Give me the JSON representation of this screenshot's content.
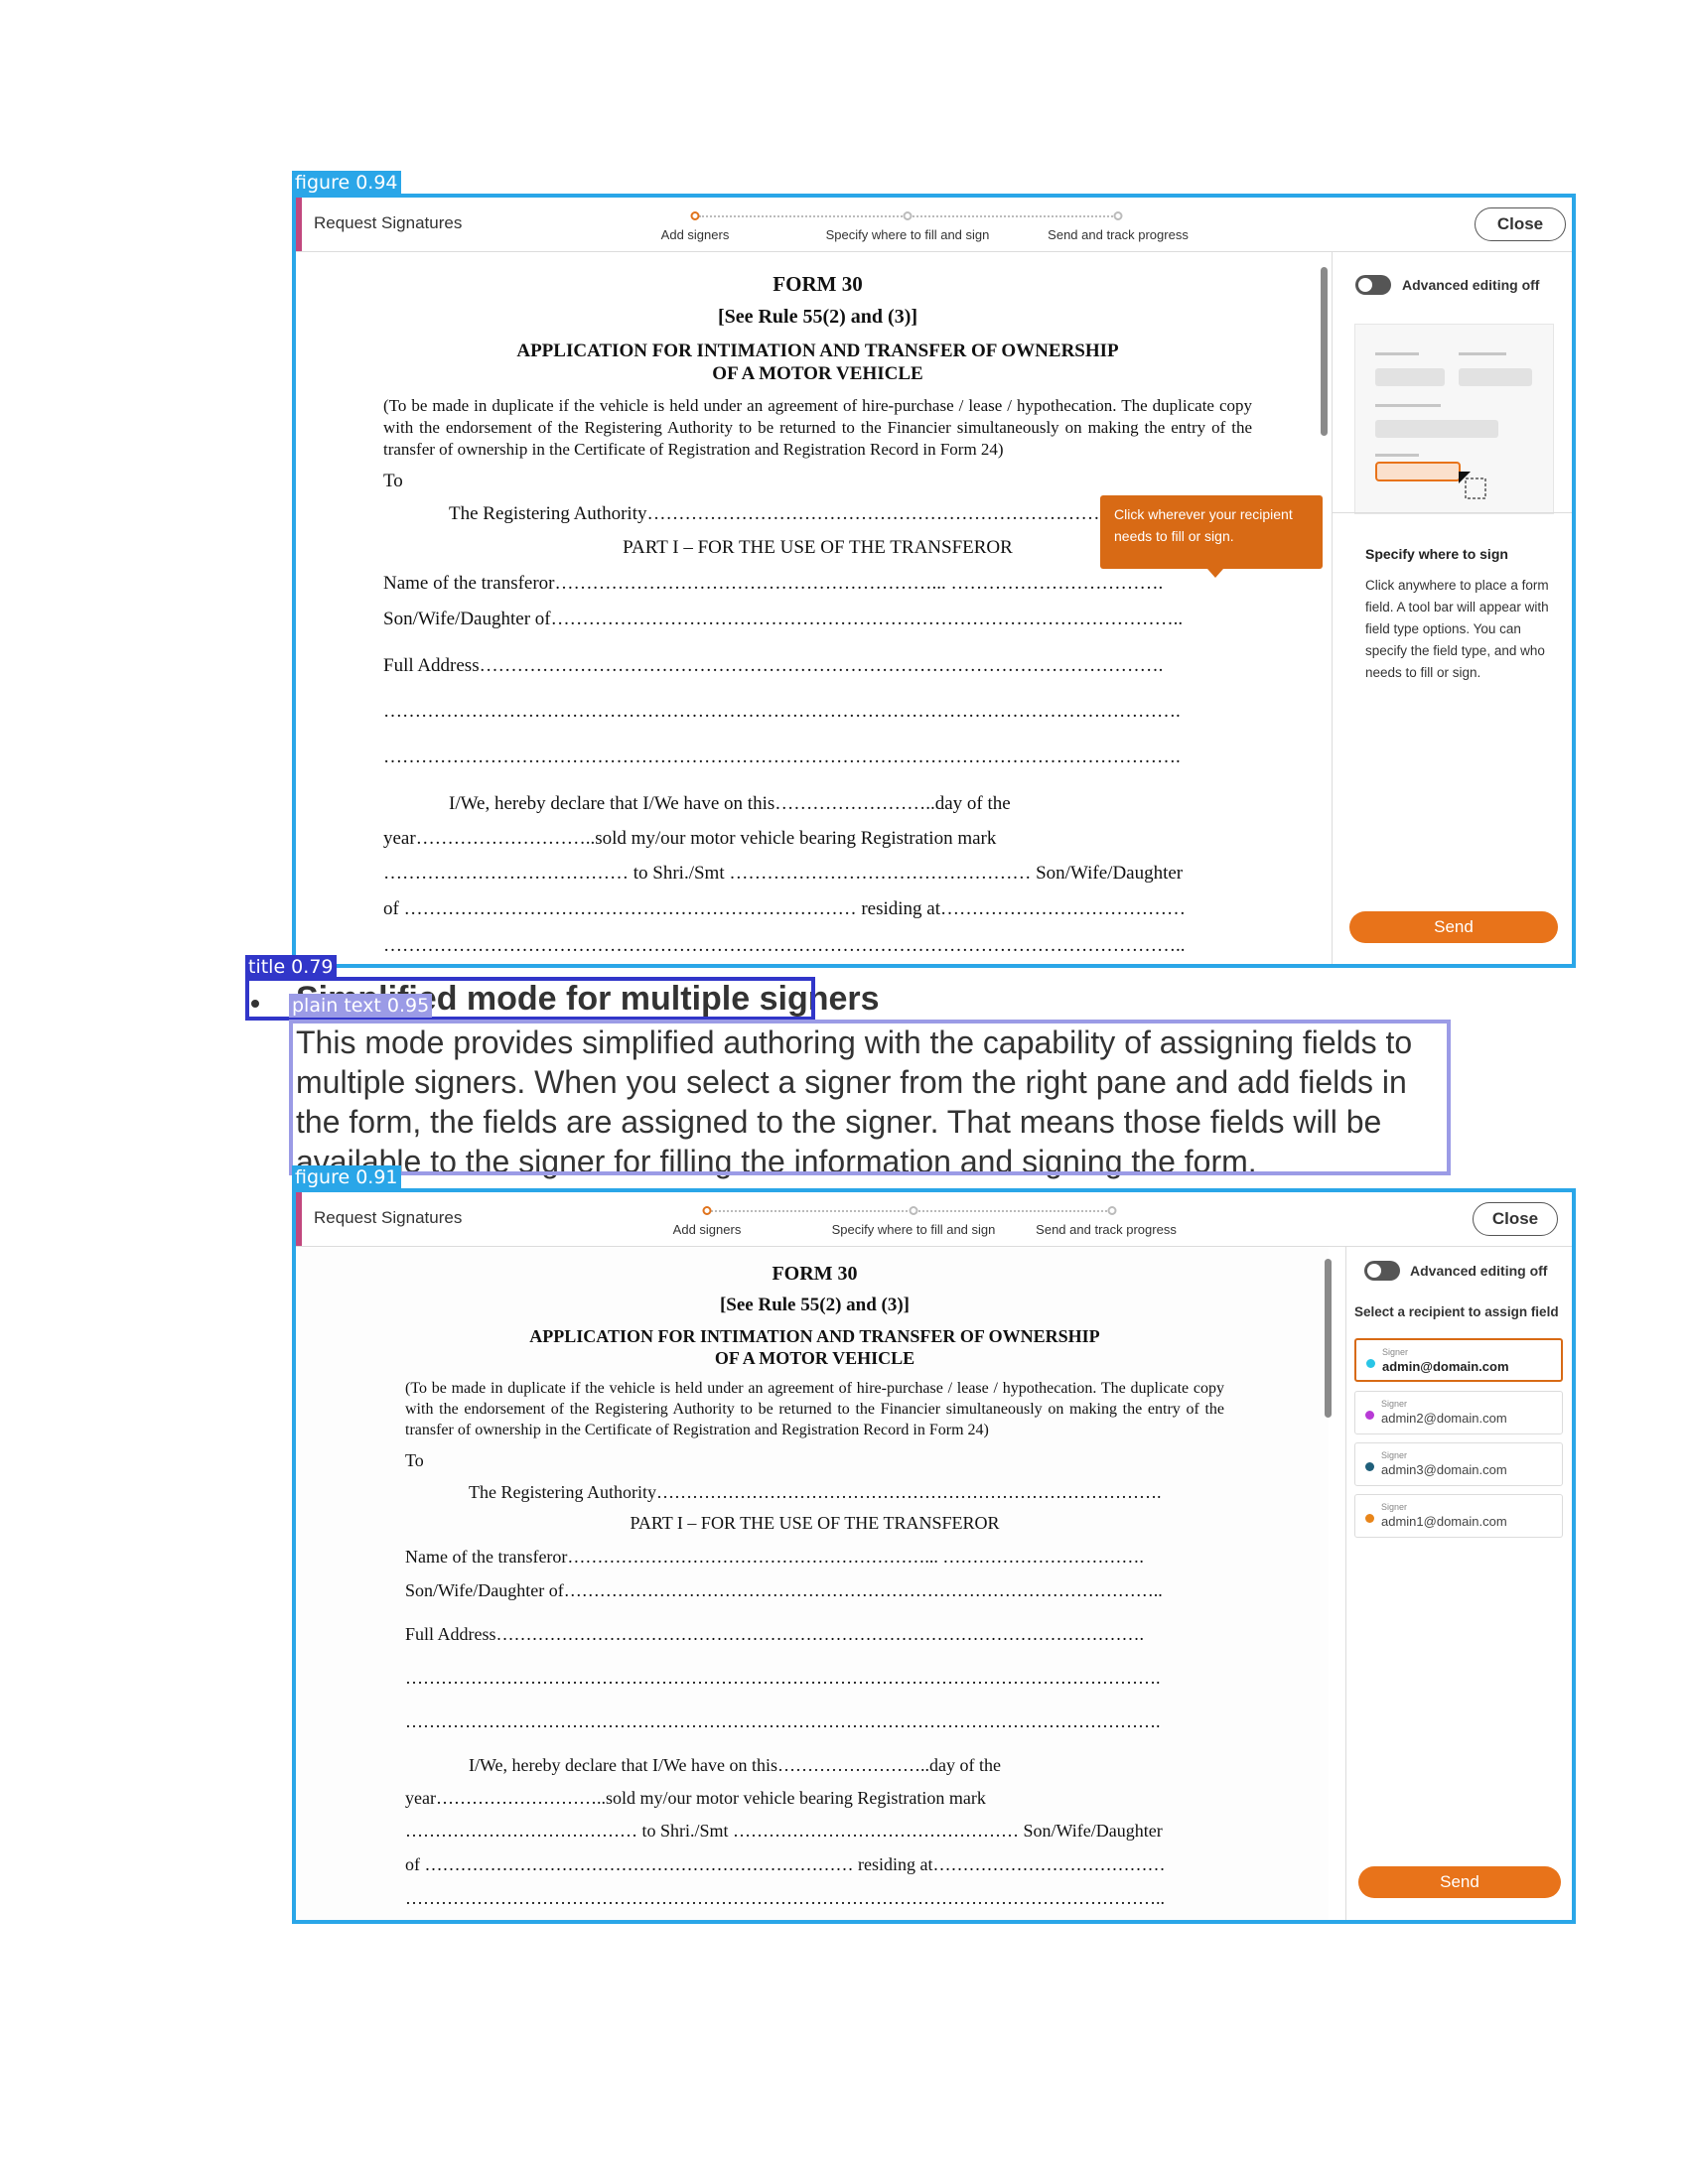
{
  "detections": {
    "figure_top": "figure 0.94",
    "title": "title 0.79",
    "plain_text": "plain text 0.95",
    "figure_bottom": "figure 0.91"
  },
  "colors": {
    "accent": "#e8731a",
    "figure_box": "#2aa6e8",
    "title_box": "#3136c9",
    "plain_box": "#9b9be6",
    "header_accent": "#c2487e"
  },
  "top_shot": {
    "header_title": "Request Signatures",
    "steps": [
      "Add signers",
      "Specify where to fill and sign",
      "Send and track progress"
    ],
    "active_step": 0,
    "close_label": "Close",
    "toggle_label": "Advanced editing off",
    "tooltip": "Click wherever your recipient needs to fill or sign.",
    "help_title": "Specify where to sign",
    "help_text": "Click anywhere to place a form field. A tool bar will appear with field type options. You can specify the field type, and who needs to fill or sign.",
    "send_label": "Send"
  },
  "bottom_shot": {
    "header_title": "Request Signatures",
    "steps": [
      "Add signers",
      "Specify where to fill and sign",
      "Send and track progress"
    ],
    "active_step": 0,
    "close_label": "Close",
    "toggle_label": "Advanced editing off",
    "select_label": "Select a recipient to assign field",
    "signers": [
      {
        "role": "Signer",
        "email": "admin@domain.com",
        "color": "#29c5e6",
        "selected": true
      },
      {
        "role": "Signer",
        "email": "admin2@domain.com",
        "color": "#b83ad6",
        "selected": false
      },
      {
        "role": "Signer",
        "email": "admin3@domain.com",
        "color": "#1f5f7a",
        "selected": false
      },
      {
        "role": "Signer",
        "email": "admin1@domain.com",
        "color": "#e8851a",
        "selected": false
      }
    ],
    "send_label": "Send"
  },
  "form": {
    "title": "FORM 30",
    "rule": "[See Rule 55(2) and (3)]",
    "heading1": "APPLICATION FOR INTIMATION AND TRANSFER OF OWNERSHIP",
    "heading2": "OF A MOTOR VEHICLE",
    "note": "(To be made in duplicate if the vehicle is held under an agreement of hire-purchase / lease / hypothecation. The duplicate copy with the endorsement of the Registering Authority to be returned to the Financier simultaneously on making the entry of the transfer of ownership in the Certificate of Registration and Registration Record in Form 24)",
    "to": "To",
    "authority": "The Registering Authority………………………………………………………………………….",
    "part": "PART I – FOR THE USE OF THE TRANSFEROR",
    "name": "Name of the transferor……………………………………………………... …………………………….",
    "son": "Son/Wife/Daughter of………………………………………………………………………………………..",
    "address": "Full Address……………………………………………………………………………………………….",
    "blank1": "……………………………………………………………………………………………………………….",
    "blank2": "……………………………………………………………………………………………………………….",
    "declare": "I/We,  hereby  declare  that  I/We  have  on  this……………………..day  of  the",
    "year": "year………………………..sold   my/our   motor   vehicle   bearing   Registration   mark",
    "shri": "………………………………… to Shri./Smt ………………………………………… Son/Wife/Daughter",
    "of": "of ……………………………………………………………… residing at…………………………………",
    "blank3": "……………………………………………………………………………………………………………….."
  },
  "section": {
    "title": "Simplified mode for multiple signers",
    "body": "This mode provides simplified authoring with the capability of assigning fields to multiple signers. When you select a signer from the right pane and add fields in the form, the fields are assigned to the signer. That means those fields will be available to the signer for filling the information and signing the form."
  }
}
